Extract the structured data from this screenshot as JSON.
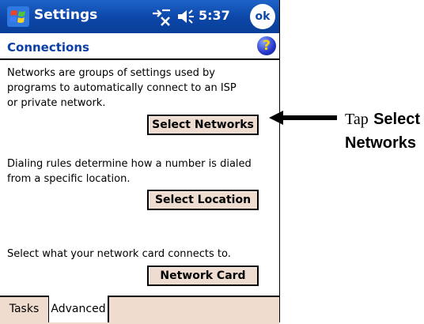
{
  "titlebar": {
    "app_title": "Settings",
    "clock": "5:37",
    "ok_label": "ok"
  },
  "header": {
    "title": "Connections",
    "help_glyph": "?"
  },
  "sections": [
    {
      "description": "Networks are groups of settings used by\nprograms to automatically connect to an ISP\nor private network.",
      "button": "Select Networks"
    },
    {
      "description": "Dialing rules determine how a number is dialed\nfrom a specific location.",
      "button": "Select Location"
    },
    {
      "description": "Select what your network card connects to.",
      "button": "Network Card"
    }
  ],
  "tabs": [
    {
      "label": "Tasks",
      "active": false
    },
    {
      "label": "Advanced",
      "active": true
    }
  ],
  "callout": {
    "prefix": "Tap",
    "bold_1": "Select",
    "bold_2": "Networks"
  },
  "icons": {
    "start": "windows-flag-icon",
    "connectivity": "connectivity-icon",
    "volume": "speaker-icon",
    "help": "help-icon",
    "pointer": "arrow-left-icon"
  },
  "colors": {
    "titlebar": "#0b46a8",
    "header_text": "#0b3fa6",
    "button_bg": "#efdcd0",
    "tabbar_bg": "#f0dccf"
  }
}
